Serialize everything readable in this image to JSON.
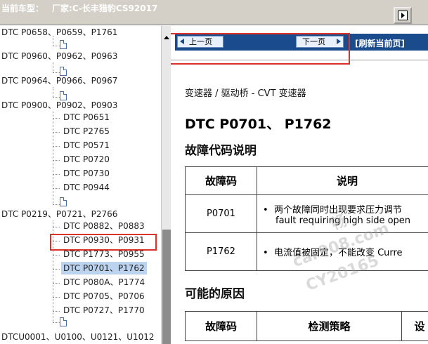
{
  "header": {
    "title_label": "当前车型：",
    "title_value": "厂家:C-长丰猎豹CS92017"
  },
  "tree": {
    "groups": [
      {
        "label": "DTC P0658、P0659、P1761"
      },
      {
        "label": "DTC P0960、P0962、P0963"
      },
      {
        "label": "DTC P0964、P0966、P0967"
      },
      {
        "label": "DTC P0900、P0902、P0903"
      },
      {
        "label": "DTC P0219、P0721、P2766"
      },
      {
        "label": "DTCU0001、U0100、U0121、U1012"
      }
    ],
    "children_a": [
      "DTC P0651",
      "DTC P2765",
      "DTC P0571",
      "DTC P0720",
      "DTC P0730",
      "DTC P0944"
    ],
    "children_b": [
      "DTC P0882、P0883",
      "DTC P0930、P0931",
      "DTC P1773、P0955",
      "DTC P0701、P1762",
      "DTC P080A、P1774",
      "DTC P0705、P0706",
      "DTC P0727、P1770"
    ]
  },
  "nav": {
    "prev_label": "上一页",
    "next_label": "下一页",
    "refresh_label": "[刷新当前页]"
  },
  "doc": {
    "breadcrumb": "变速器 / 驱动桥 - CVT 变速器",
    "title": "DTC P0701、 P1762",
    "section1": "故障代码说明",
    "table1": {
      "headers": [
        "故障码",
        "说明"
      ],
      "rows": [
        {
          "code": "P0701",
          "desc1": "两个故障同时出现要求压力调节",
          "desc2": "fault requiring high side open"
        },
        {
          "code": "P1762",
          "desc1": "电流值被固定，不能改变 Curre",
          "desc2": ""
        }
      ]
    },
    "section2": "可能的原因",
    "table2": {
      "headers": [
        "故障码",
        "检测策略",
        "设"
      ]
    }
  },
  "watermark": {
    "line1": "畅",
    "line2": "car908.com",
    "line3": "CY20165"
  }
}
